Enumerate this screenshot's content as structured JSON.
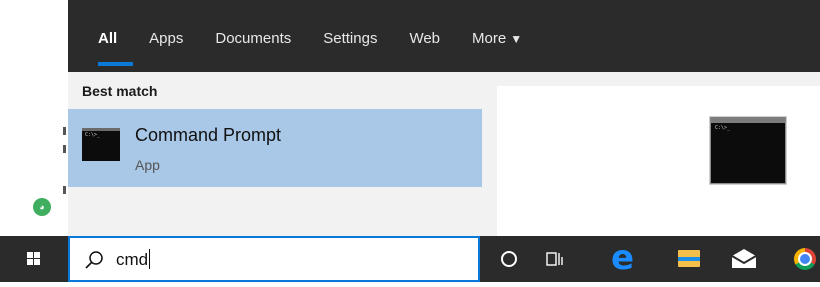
{
  "tabs": [
    {
      "label": "All",
      "active": true
    },
    {
      "label": "Apps"
    },
    {
      "label": "Documents"
    },
    {
      "label": "Settings"
    },
    {
      "label": "Web"
    },
    {
      "label": "More",
      "icon": "caret-down-icon"
    }
  ],
  "results": {
    "section_title": "Best match",
    "best_match": {
      "title": "Command Prompt",
      "subtitle": "App",
      "icon": "command-prompt-icon"
    }
  },
  "preview": {
    "icon": "command-prompt-icon"
  },
  "search": {
    "query": "cmd",
    "icon": "search-icon"
  },
  "taskbar": {
    "items": [
      "windows-start-icon",
      "cortana-icon",
      "task-view-icon",
      "edge-icon",
      "file-explorer-icon",
      "mail-icon",
      "chrome-icon"
    ]
  },
  "colors": {
    "accent": "#0a78d7",
    "highlight": "#a9c7e6",
    "tabbar": "#2b2b2b"
  }
}
